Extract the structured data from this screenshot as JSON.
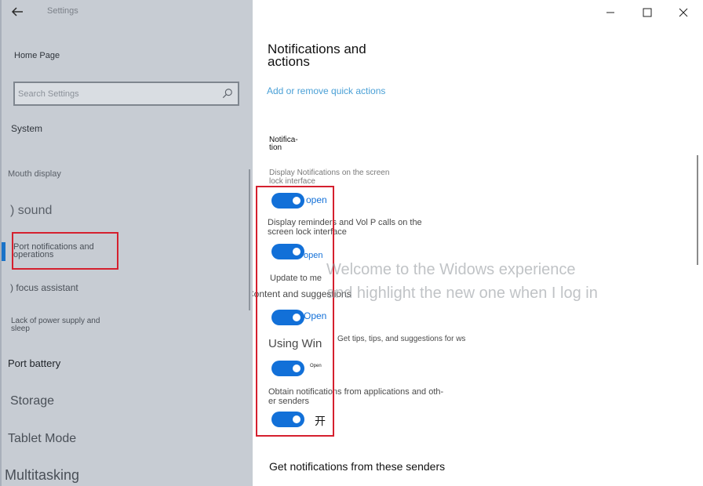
{
  "window": {
    "title": "Settings"
  },
  "sidebar": {
    "home": "Home Page",
    "search_placeholder": "Search Settings",
    "section": "System",
    "items": [
      {
        "label": "Mouth display"
      },
      {
        "label": ") sound"
      },
      {
        "label": "Port notifications and operations"
      },
      {
        "label": ") focus assistant"
      },
      {
        "label": "Lack of power supply and sleep"
      },
      {
        "label": "Port battery"
      },
      {
        "label": "Storage"
      },
      {
        "label": "Tablet Mode"
      },
      {
        "label": "Multitasking"
      }
    ]
  },
  "main": {
    "title": "Notifications and actions",
    "quick_actions_link": "Add or remove quick actions",
    "section_heading": "Notifica- tion",
    "settings": [
      {
        "description": "Display Notifications on the screen lock interface",
        "state": "open"
      },
      {
        "description": "Display reminders and Vol P calls on the screen lock interface",
        "state": "open"
      },
      {
        "description": "Update to me",
        "state": "Open"
      },
      {
        "description": "Content and suggestions",
        "state": ""
      },
      {
        "description": "Using Win",
        "state": "Open"
      },
      {
        "description": "Get tips, tips, and suggestions for ws",
        "state": ""
      },
      {
        "description": "Obtain notifications from applications and oth- er senders",
        "state": "开"
      }
    ],
    "senders_heading": "Get notifications from these senders"
  },
  "overlay": {
    "line1": "Welcome to the Widows experience",
    "line2": "and highlight the new one when I log in"
  },
  "colors": {
    "accent": "#1270d8",
    "link": "#4aa0d6",
    "highlight": "#d5202e",
    "sidebar_bg": "#c7ccd3"
  }
}
